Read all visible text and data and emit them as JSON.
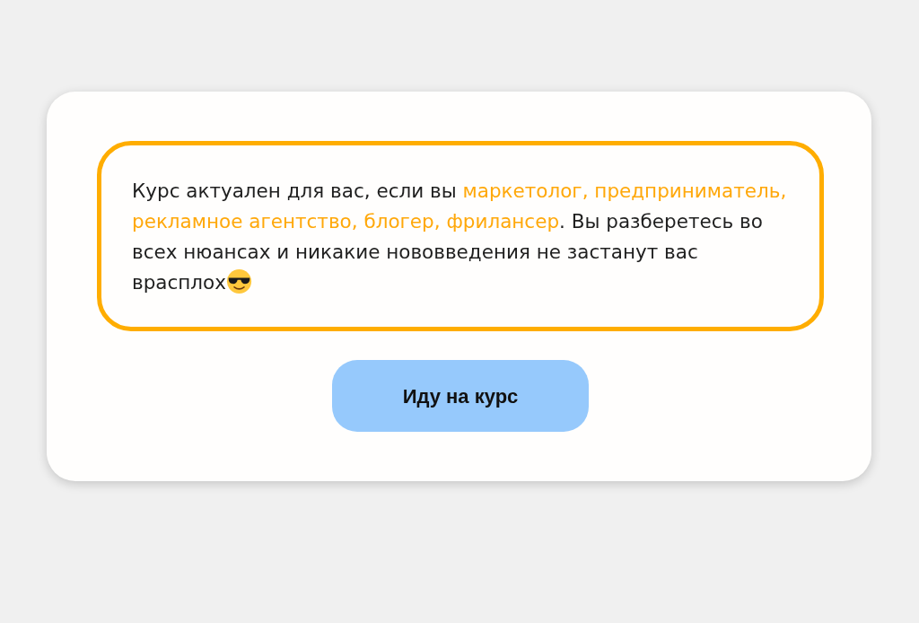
{
  "info_box": {
    "segments": [
      {
        "text": "Курс актуален для вас, если вы ",
        "highlighted": false
      },
      {
        "text": "маркетолог, предприниматель, рекламное агентство, блогер, фрилансер",
        "highlighted": true
      },
      {
        "text": ". Вы разберетесь во всех нюансах и никакие нововведения не застанут вас врасплох",
        "highlighted": false
      }
    ]
  },
  "button": {
    "label": "Иду на курс"
  }
}
